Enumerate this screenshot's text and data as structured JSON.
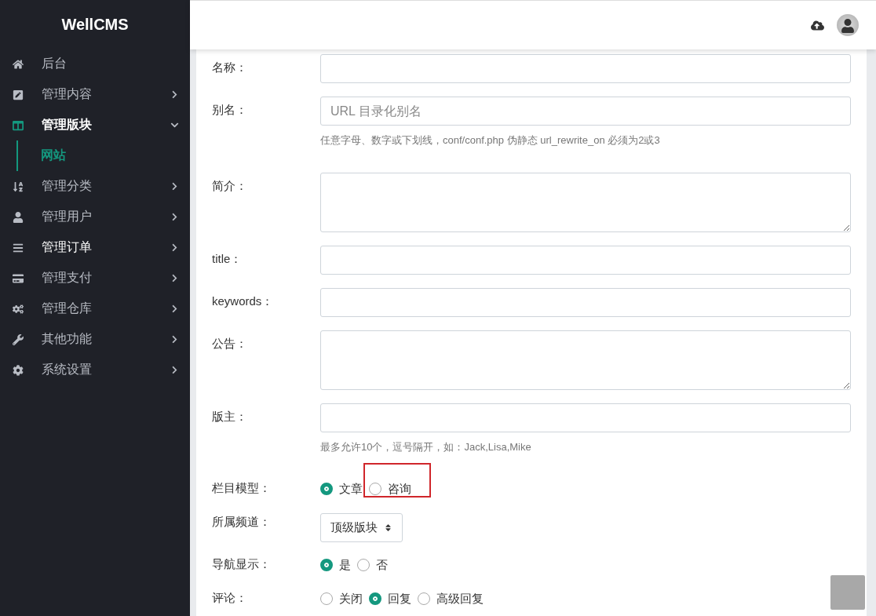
{
  "sidebar": {
    "brand": "WellCMS",
    "items": [
      {
        "label": "后台",
        "selected": false,
        "highlighted": false,
        "has_arrow": false,
        "expanded": false
      },
      {
        "label": "管理内容",
        "selected": false,
        "highlighted": false,
        "has_arrow": true,
        "expanded": false
      },
      {
        "label": "管理版块",
        "selected": true,
        "highlighted": false,
        "has_arrow": true,
        "expanded": true,
        "children": [
          {
            "label": "网站",
            "selected": true
          }
        ]
      },
      {
        "label": "管理分类",
        "selected": false,
        "highlighted": false,
        "has_arrow": true,
        "expanded": false
      },
      {
        "label": "管理用户",
        "selected": false,
        "highlighted": false,
        "has_arrow": true,
        "expanded": false
      },
      {
        "label": "管理订单",
        "selected": false,
        "highlighted": true,
        "has_arrow": true,
        "expanded": false
      },
      {
        "label": "管理支付",
        "selected": false,
        "highlighted": false,
        "has_arrow": true,
        "expanded": false
      },
      {
        "label": "管理仓库",
        "selected": false,
        "highlighted": false,
        "has_arrow": true,
        "expanded": false
      },
      {
        "label": "其他功能",
        "selected": false,
        "highlighted": false,
        "has_arrow": true,
        "expanded": false
      },
      {
        "label": "系统设置",
        "selected": false,
        "highlighted": false,
        "has_arrow": true,
        "expanded": false
      }
    ]
  },
  "form": {
    "fields": [
      {
        "kind": "text",
        "label": "名称："
      },
      {
        "kind": "text",
        "label": "别名：",
        "placeholder": "URL 目录化别名",
        "help": "任意字母、数字或下划线，conf/conf.php 伪静态 url_rewrite_on 必须为2或3"
      },
      {
        "kind": "textarea",
        "label": "简介："
      },
      {
        "kind": "text",
        "label": "title："
      },
      {
        "kind": "text",
        "label": "keywords："
      },
      {
        "kind": "textarea",
        "label": "公告："
      },
      {
        "kind": "text",
        "label": "版主：",
        "help": "最多允许10个，逗号隔开，如：Jack,Lisa,Mike"
      },
      {
        "kind": "radio",
        "label": "栏目模型：",
        "options": [
          {
            "label": "文章",
            "selected": true,
            "highlighted": false
          },
          {
            "label": "咨询",
            "selected": false,
            "highlighted": true
          }
        ]
      },
      {
        "kind": "select",
        "label": "所属频道：",
        "value": "顶级版块"
      },
      {
        "kind": "radio",
        "label": "导航显示：",
        "options": [
          {
            "label": "是",
            "selected": true,
            "highlighted": false
          },
          {
            "label": "否",
            "selected": false,
            "highlighted": false
          }
        ]
      },
      {
        "kind": "radio",
        "label": "评论：",
        "options": [
          {
            "label": "关闭",
            "selected": false,
            "highlighted": false
          },
          {
            "label": "回复",
            "selected": true,
            "highlighted": false
          },
          {
            "label": "高级回复",
            "selected": false,
            "highlighted": false
          }
        ]
      }
    ]
  }
}
